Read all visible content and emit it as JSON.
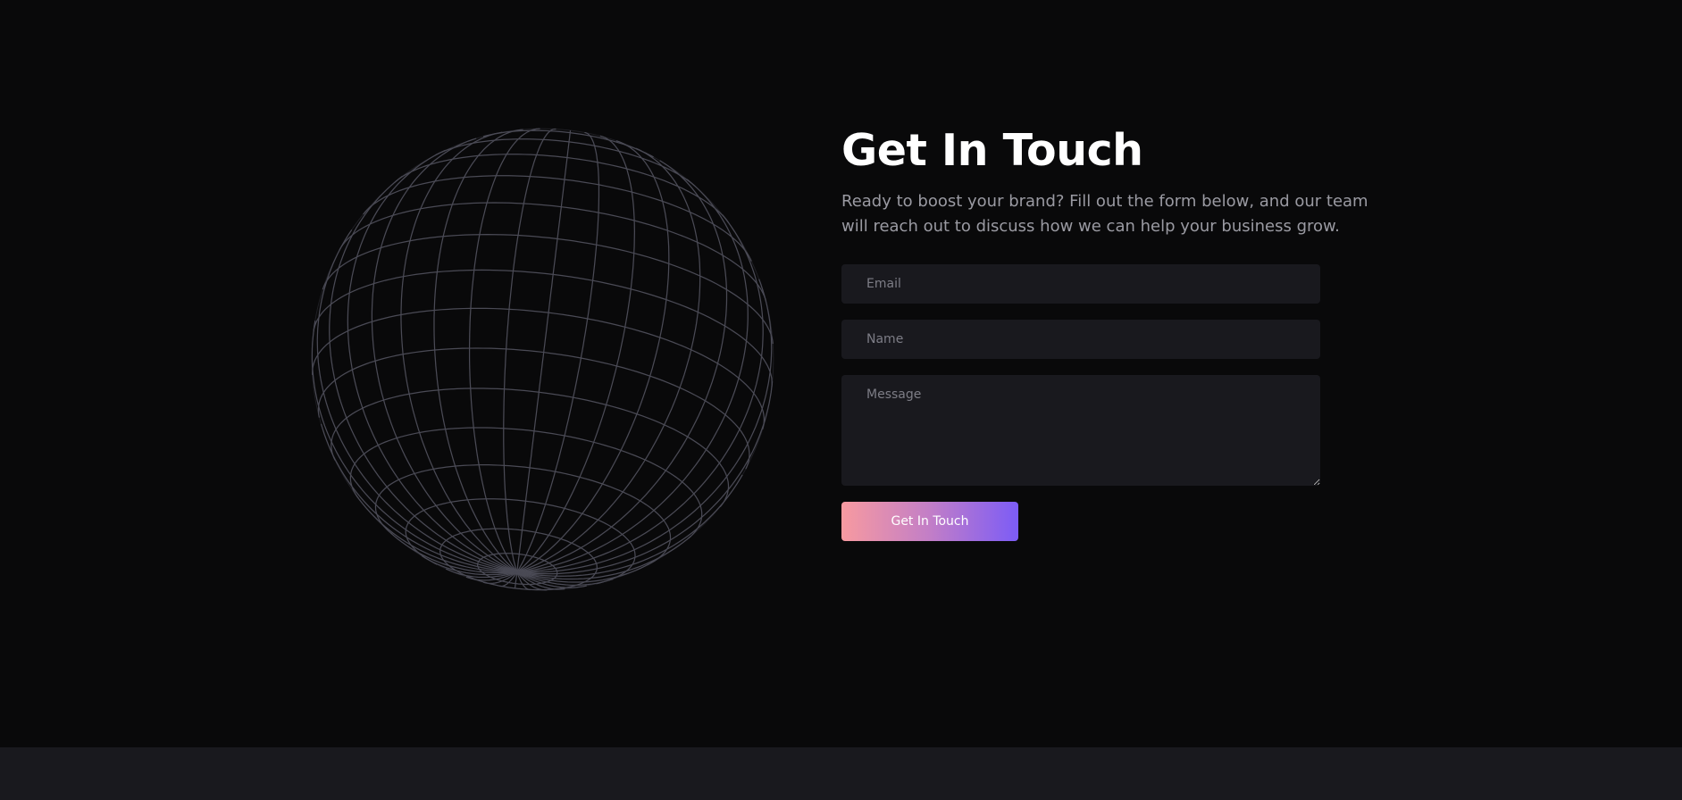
{
  "contact": {
    "title": "Get In Touch",
    "subtitle": "Ready to boost your brand? Fill out the form below, and our team will reach out to discuss how we can help your business grow.",
    "form": {
      "email_placeholder": "Email",
      "name_placeholder": "Name",
      "message_placeholder": "Message",
      "submit_label": "Get In Touch"
    }
  },
  "decoration": {
    "globe_icon": "wireframe-globe-icon",
    "globe_line_color": "#4a4a55"
  },
  "colors": {
    "background": "#09090a",
    "field_background": "#19191e",
    "footer_band": "#19191e",
    "button_gradient_start": "#f79aa0",
    "button_gradient_end": "#7c5cf6"
  }
}
